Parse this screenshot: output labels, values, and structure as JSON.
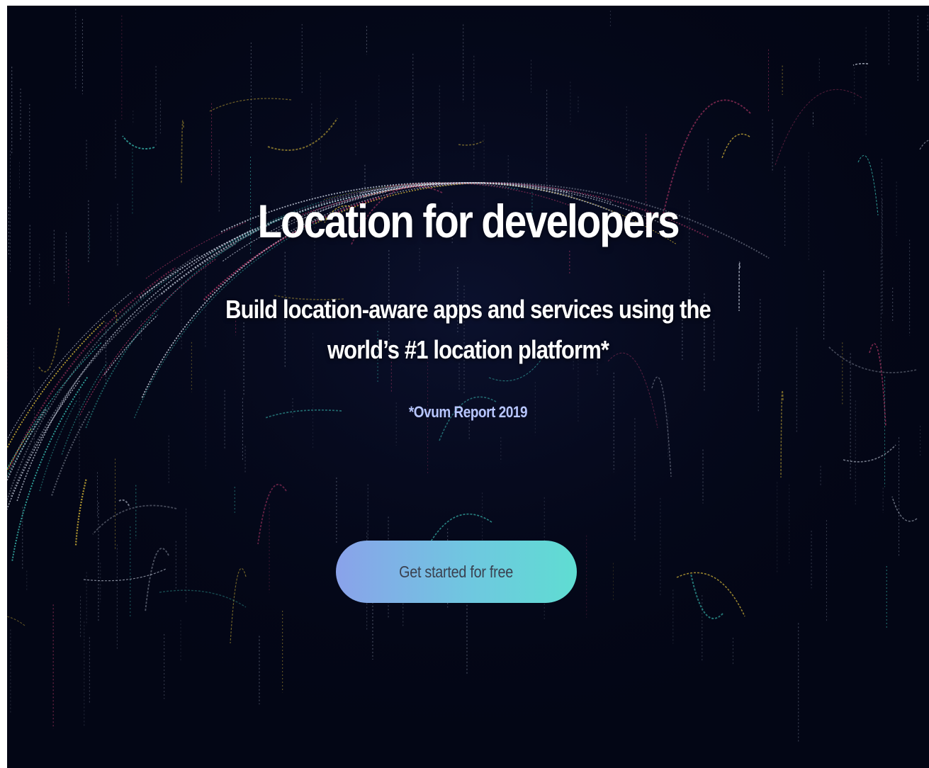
{
  "hero": {
    "title": "Location for developers",
    "subtitle_line1": "Build location-aware apps and services using the",
    "subtitle_line2": "world’s #1 location platform*",
    "footnote": "*Ovum Report 2019",
    "cta_label": "Get started for free"
  },
  "colors": {
    "background": "#030615",
    "title": "#ffffff",
    "footnote": "#b8c6ff",
    "cta_gradient_start": "#8aa2ea",
    "cta_gradient_end": "#5fddd2",
    "cta_text": "#3a4150",
    "stream_teal": "#3fd1c4",
    "stream_pink": "#e0447a",
    "stream_yellow": "#e5c33a",
    "stream_white": "#cfd6e6"
  },
  "background_art": "data-stream-globe"
}
